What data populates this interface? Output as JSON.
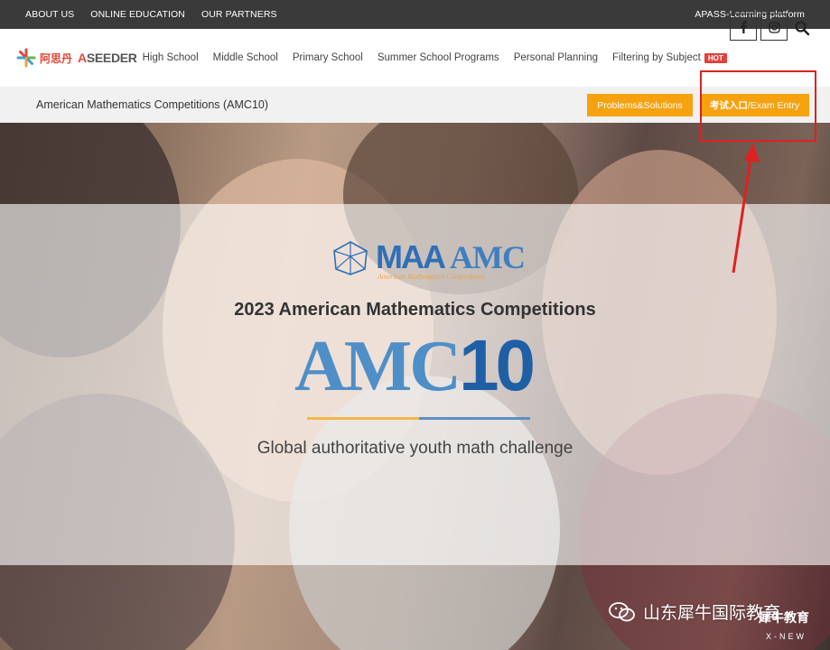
{
  "topbar": {
    "links": [
      "ABOUT US",
      "ONLINE EDUCATION",
      "OUR PARTNERS"
    ],
    "right_link": "APASS-Learning platform"
  },
  "logo": {
    "cn": "阿思丹",
    "en_a": "A",
    "en_rest": "SEEDER"
  },
  "nav": {
    "items": [
      "High School",
      "Middle School",
      "Primary School",
      "Summer School Programs",
      "Personal Planning",
      "Filtering by Subject"
    ],
    "hot_badge": "HOT"
  },
  "subbar": {
    "title": "American Mathematics Competitions (AMC10)",
    "problems_button": "Problems&Solutions",
    "exam_button_cn": "考试入口",
    "exam_button_en": "/Exam Entry"
  },
  "hero": {
    "maa": "MAA",
    "amc": "AMC",
    "maa_tagline": "American Mathematics Competitions",
    "title": "2023 American Mathematics Competitions",
    "big_amc": "AMC",
    "big_num": "10",
    "subtitle": "Global authoritative youth math challenge"
  },
  "watermark": {
    "text": "山东犀牛国际教育",
    "brand_cn": "犀牛教育",
    "brand_en": "X-NEW"
  },
  "colors": {
    "accent": "#f6a20f",
    "hot": "#e0413a",
    "amc_blue": "#1f5fa5",
    "annotation": "#e02020"
  },
  "icons": [
    "facebook-icon",
    "instagram-icon",
    "search-icon",
    "wechat-icon",
    "logo-star-icon"
  ]
}
